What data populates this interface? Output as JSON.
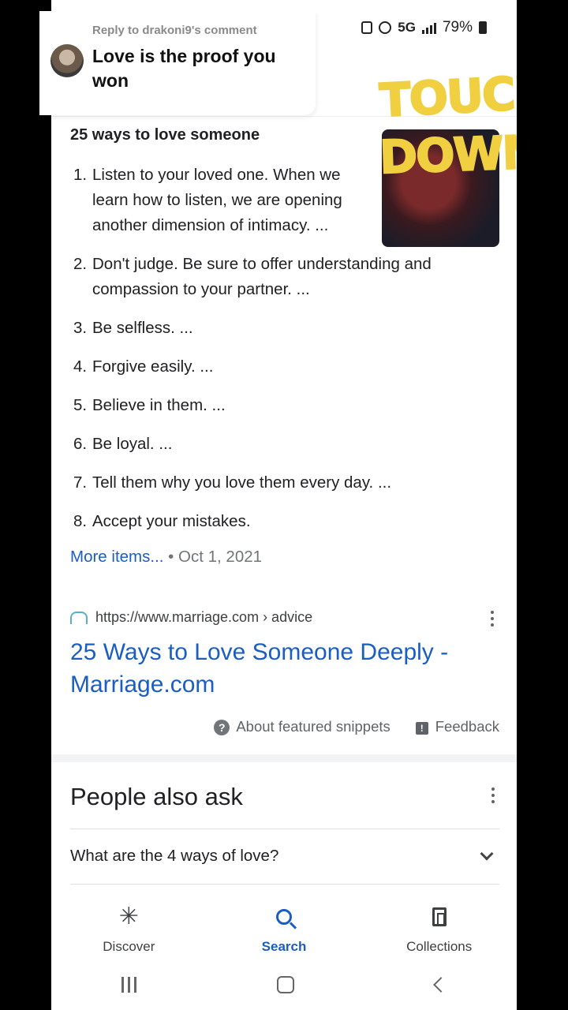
{
  "status_bar": {
    "network": "5G",
    "battery": "79%"
  },
  "reply": {
    "label": "Reply to drakoni9's comment",
    "text": "Love is the proof you won"
  },
  "sticker": {
    "line1": "TOUCH",
    "line2": "DOWN"
  },
  "snippet": {
    "title": "25 ways to love someone",
    "items": [
      {
        "num": "1.",
        "text": "Listen to your loved one. When we learn how to listen, we are opening another dimension of intimacy. ..."
      },
      {
        "num": "2.",
        "text": "Don't judge. Be sure to offer understanding and compassion to your partner. ..."
      },
      {
        "num": "3.",
        "text": "Be selfless. ..."
      },
      {
        "num": "4.",
        "text": "Forgive easily. ..."
      },
      {
        "num": "5.",
        "text": "Believe in them. ..."
      },
      {
        "num": "6.",
        "text": "Be loyal. ..."
      },
      {
        "num": "7.",
        "text": "Tell them why you love them every day. ..."
      },
      {
        "num": "8.",
        "text": "Accept your mistakes."
      }
    ],
    "more_items": "More items...",
    "date": " • Oct 1, 2021"
  },
  "source": {
    "url": "https://www.marriage.com › advice",
    "title": "25 Ways to Love Someone Deeply - Marriage.com"
  },
  "snippet_footer": {
    "about": "About featured snippets",
    "feedback": "Feedback"
  },
  "people_also_ask": {
    "title": "People also ask",
    "questions": [
      "What are the 4 ways of love?"
    ]
  },
  "bottom_nav": {
    "discover": "Discover",
    "search": "Search",
    "collections": "Collections"
  },
  "colors": {
    "link": "#1a5ec4",
    "sticker_yellow": "#f0d040"
  }
}
